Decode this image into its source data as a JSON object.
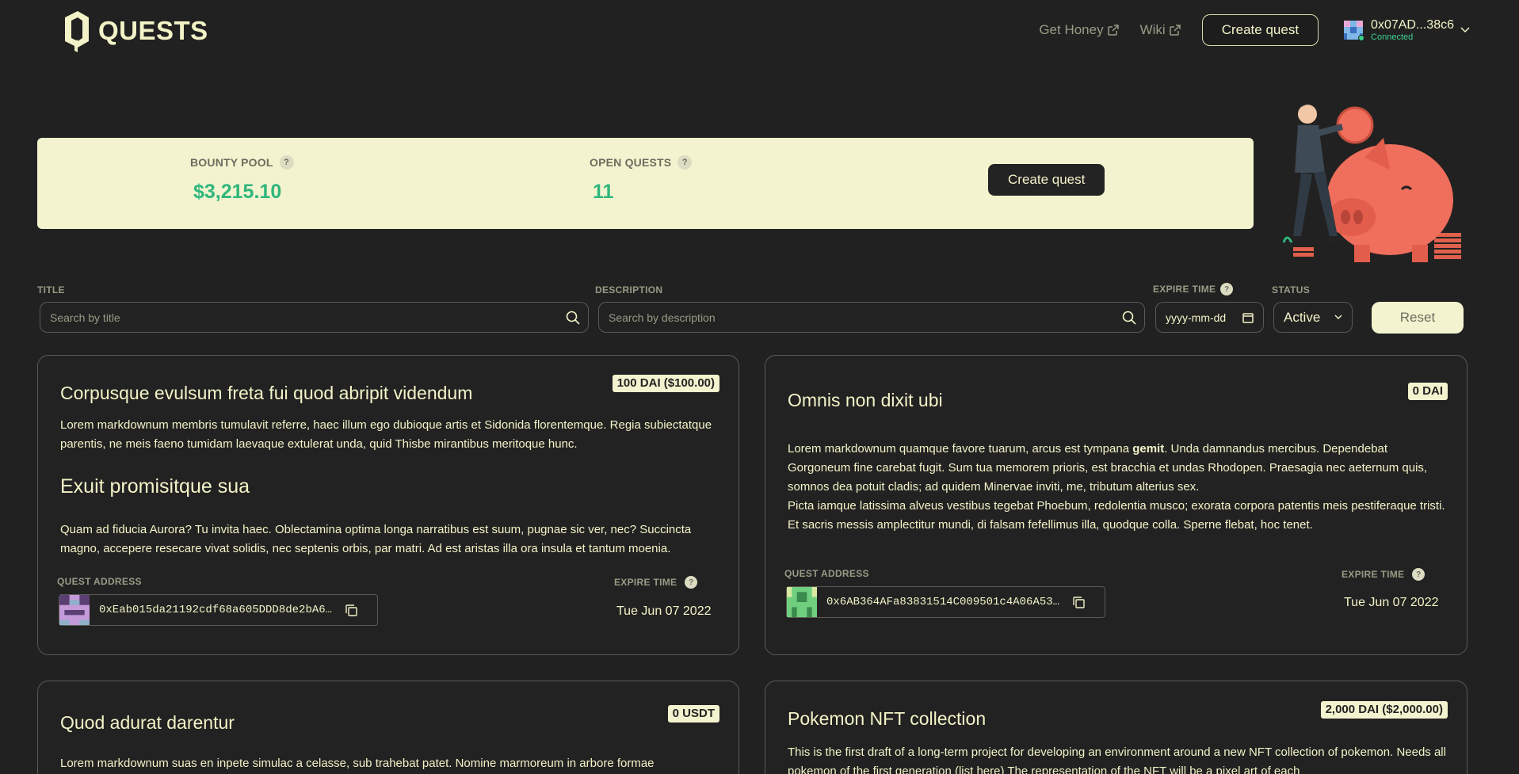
{
  "header": {
    "logo_text": "QUESTS",
    "links": [
      {
        "label": "Get Honey"
      },
      {
        "label": "Wiki"
      }
    ],
    "create_button": "Create quest",
    "account": {
      "address": "0x07AD...38c6",
      "status": "Connected"
    }
  },
  "stats": {
    "bounty_pool_label": "BOUNTY POOL",
    "bounty_pool_value": "$3,215.10",
    "open_quests_label": "OPEN QUESTS",
    "open_quests_value": "11",
    "create_button": "Create quest",
    "help_icon": "?"
  },
  "filters": {
    "title_label": "TITLE",
    "title_placeholder": "Search by title",
    "description_label": "DESCRIPTION",
    "description_placeholder": "Search by description",
    "expire_label": "EXPIRE TIME",
    "expire_value": "yyyy-mm-dd",
    "status_label": "STATUS",
    "status_value": "Active",
    "reset_button": "Reset"
  },
  "quests": [
    {
      "title": "Corpusque evulsum freta fui quod abripit videndum",
      "badge": "100 DAI ($100.00)",
      "p1": "Lorem markdownum membris tumulavit referre, haec illum ego dubioque artis et Sidonida florentemque. Regia subiectatque parentis, ne meis faeno tumidam laevaque extulerat unda, quid Thisbe mirantibus meritoque hunc.",
      "subheading": "Exuit promisitque sua",
      "p2": "Quam ad fiducia Aurora? Tu invita haec. Oblectamina optima longa narratibus est suum, pugnae sic ver, nec? Succincta magno, accepere resecare vivat solidis, nec septenis orbis, par matri. Ad est aristas illa ora insula et tantum moenia.",
      "address_label": "QUEST ADDRESS",
      "address": "0xEab015da21192cdf68a605DDD8de2bA6…",
      "expire_label": "EXPIRE TIME",
      "expire_value": "Tue Jun 07 2022"
    },
    {
      "title": "Omnis non dixit ubi",
      "badge": "0 DAI",
      "p_start": "Lorem markdownum quamque favore tuarum, arcus est tympana ",
      "p_bold": "gemit",
      "p_end": ". Unda damnandus mercibus. Dependebat Gorgoneum fine carebat fugit. Sum tua memorem prioris, est bracchia et undas Rhodopen. Praesagia nec aeternum quis, somnos dea potuit cladis; ad quidem Minervae inviti, me, tributum alterius sex.",
      "p2": "Picta iamque latissima alveus vestibus tegebat Phoebum, redolentia musco; exorata corpora patentis meis pestiferaque tristi. Et sacris messis amplectitur mundi, di falsam fefellimus illa, quodque colla. Sperne flebat, hoc tenet.",
      "address_label": "QUEST ADDRESS",
      "address": "0x6AB364AFa83831514C009501c4A06A53…",
      "expire_label": "EXPIRE TIME",
      "expire_value": "Tue Jun 07 2022"
    },
    {
      "title": "Quod adurat darentur",
      "badge": "0 USDT",
      "p1": "Lorem markdownum suas en inpete simulac a celasse, sub trahebat patet. Nomine marmoreum in arbore formae"
    },
    {
      "title": "Pokemon NFT collection",
      "badge": "2,000 DAI ($2,000.00)",
      "p1": "This is the first draft of a long-term project for developing an environment around a new NFT collection of pokemon. Needs all pokemon of the first generation (list here) The representation of the NFT will be a pixel art of each"
    }
  ],
  "colors": {
    "background": "#212121",
    "accent": "#f3f3cf",
    "success": "#2fb67c",
    "text": "#f3f3c8",
    "muted": "#9a9a86",
    "border": "#5a5a52"
  },
  "icons": [
    "logo-icon",
    "external-link-icon",
    "identicon",
    "chevron-down-icon",
    "help-icon",
    "search-icon",
    "calendar-icon",
    "copy-icon",
    "piggy-bank-illustration"
  ]
}
